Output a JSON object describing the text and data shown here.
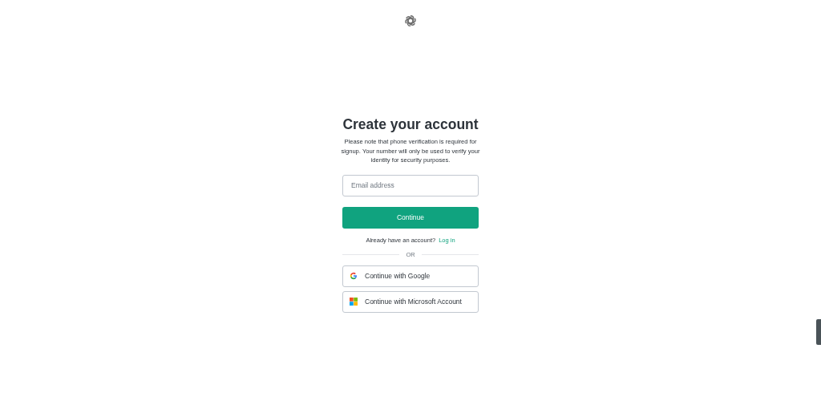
{
  "heading": "Create your account",
  "notice": "Please note that phone verification is required for signup. Your number will only be used to verify your identity for security purposes.",
  "email": {
    "placeholder": "Email address"
  },
  "continue_button": "Continue",
  "login_prompt": {
    "text": "Already have an account?",
    "link": "Log in"
  },
  "divider": "OR",
  "social_buttons": [
    {
      "kind": "google",
      "label": "Continue with Google"
    },
    {
      "kind": "microsoft",
      "label": "Continue with Microsoft Account"
    }
  ]
}
